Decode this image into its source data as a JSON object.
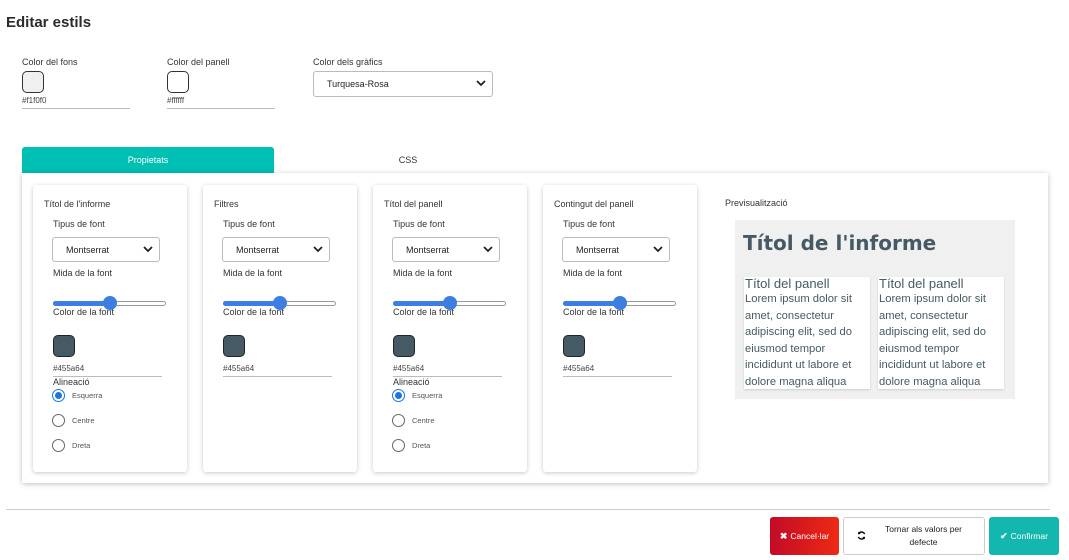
{
  "page": {
    "title": "Editar estils"
  },
  "colors": {
    "background": {
      "label": "Color del fons",
      "value": "#f1f0f0",
      "swatch": "#f1f0f0"
    },
    "panel": {
      "label": "Color del panell",
      "value": "#ffffff",
      "swatch": "#ffffff"
    },
    "charts": {
      "label": "Color dels gràfics",
      "selected": "Turquesa-Rosa"
    }
  },
  "tabs": {
    "properties": "Propietats",
    "css": "CSS"
  },
  "cards": {
    "report_title": {
      "title": "Títol de l'informe",
      "font_type_label": "Tipus de font",
      "font_type": "Montserrat",
      "font_size_label": "Mida de la font",
      "font_size_level": 0.5,
      "font_color_label": "Color de la font",
      "font_color": "#455a64",
      "align_label": "Alineació",
      "align_options": [
        "Esquerra",
        "Centre",
        "Dreta"
      ],
      "align_selected": "Esquerra"
    },
    "filters": {
      "title": "Filtres",
      "font_type_label": "Tipus de font",
      "font_type": "Montserrat",
      "font_size_label": "Mida de la font",
      "font_size_level": 0.5,
      "font_color_label": "Color de la font",
      "font_color": "#455a64"
    },
    "panel_title": {
      "title": "Títol del panell",
      "font_type_label": "Tipus de font",
      "font_type": "Montserrat",
      "font_size_label": "Mida de la font",
      "font_size_level": 0.5,
      "font_color_label": "Color de la font",
      "font_color": "#455a64",
      "align_label": "Alineació",
      "align_options": [
        "Esquerra",
        "Centre",
        "Dreta"
      ],
      "align_selected": "Esquerra"
    },
    "panel_content": {
      "title": "Contingut del panell",
      "font_type_label": "Tipus de font",
      "font_type": "Montserrat",
      "font_size_label": "Mida de la font",
      "font_size_level": 0.5,
      "font_color_label": "Color de la font",
      "font_color": "#455a64"
    }
  },
  "preview": {
    "label": "Previsualització",
    "report_title": "Títol de l'informe",
    "panels": [
      {
        "title": "Títol del panell",
        "text": "Lorem ipsum dolor sit amet, consectetur adipiscing elit, sed do eiusmod tempor incididunt ut labore et dolore magna aliqua"
      },
      {
        "title": "Títol del panell",
        "text": "Lorem ipsum dolor sit amet, consectetur adipiscing elit, sed do eiusmod tempor incididunt ut labore et dolore magna aliqua"
      }
    ]
  },
  "buttons": {
    "cancel": "Cancel·lar",
    "reset": "Tornar als valors per defecte",
    "confirm": "Confirmar"
  },
  "theme": {
    "accent": "#00bfb3",
    "slider": "#3d7ee3",
    "danger": "#d81b2a",
    "confirm": "#14b7ae"
  },
  "icons": {
    "chevron": "chevron-down-icon",
    "cancel": "x-icon",
    "reset": "refresh-icon",
    "confirm": "check-icon"
  }
}
